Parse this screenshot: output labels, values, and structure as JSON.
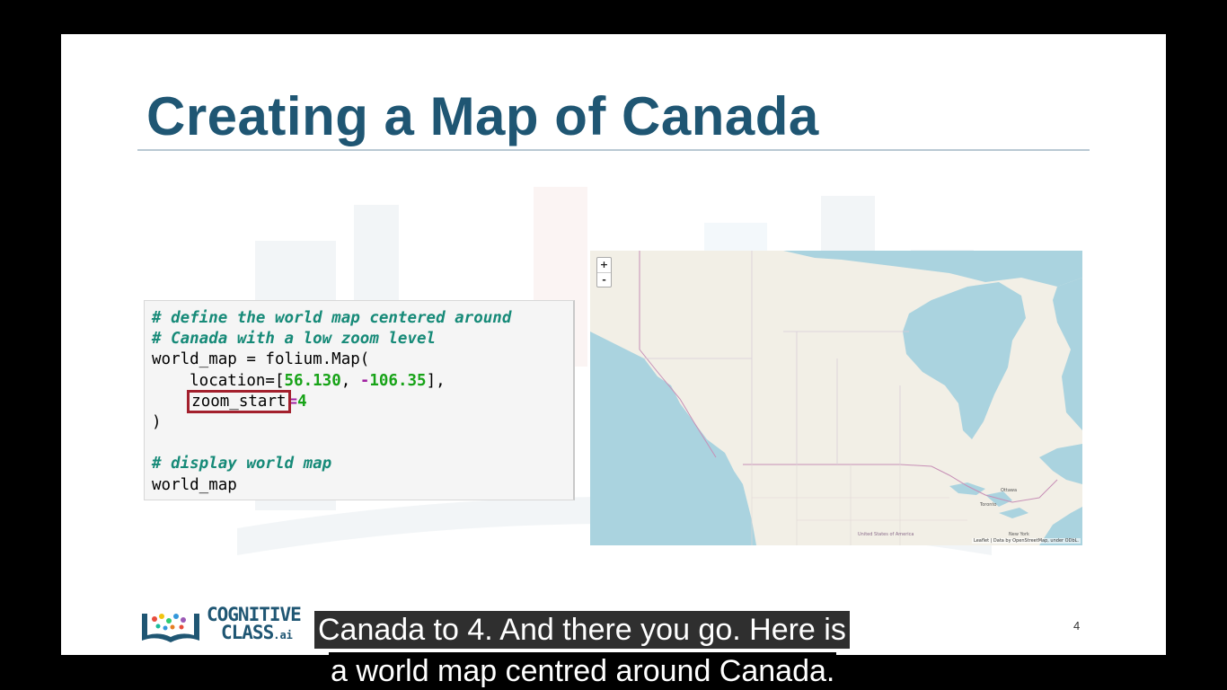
{
  "slide": {
    "title": "Creating a Map of Canada",
    "page_number": "4"
  },
  "code": {
    "lines": [
      {
        "comment": "# define the world map centered around"
      },
      {
        "comment": "# Canada with a low zoom level"
      },
      {
        "text": "world_map = folium.Map("
      },
      {
        "prefix": "    location=[",
        "lat": "56.130",
        "sep": ", ",
        "neg": "-",
        "lon": "106.35",
        "suffix": "],"
      },
      {
        "indent": "    ",
        "highlighted": "zoom_start",
        "eq": "=",
        "value": "4"
      },
      {
        "text": ")"
      },
      {
        "text": ""
      },
      {
        "comment": "# display world map"
      },
      {
        "text": "world_map"
      }
    ]
  },
  "map": {
    "zoom_in": "+",
    "zoom_out": "-",
    "cities": [
      "Ottawa",
      "Toronto",
      "New York",
      "United States of America"
    ],
    "attribution": "Leaflet | Data by OpenStreetMap, under ODbL.",
    "zoom_level": 4,
    "center": [
      56.13,
      -106.35
    ]
  },
  "logo": {
    "line1": "COGNITIVE",
    "line2": "CLASS",
    "suffix": ".ai"
  },
  "subtitles": {
    "line1": "Canada to 4. And there you go. Here is",
    "line2": "a world map centred around Canada."
  },
  "colors": {
    "title": "#1f5673",
    "comment": "#168a78",
    "number": "#17a317",
    "highlight_box": "#a3202d",
    "water": "#aad3df",
    "land": "#f2efe6"
  }
}
